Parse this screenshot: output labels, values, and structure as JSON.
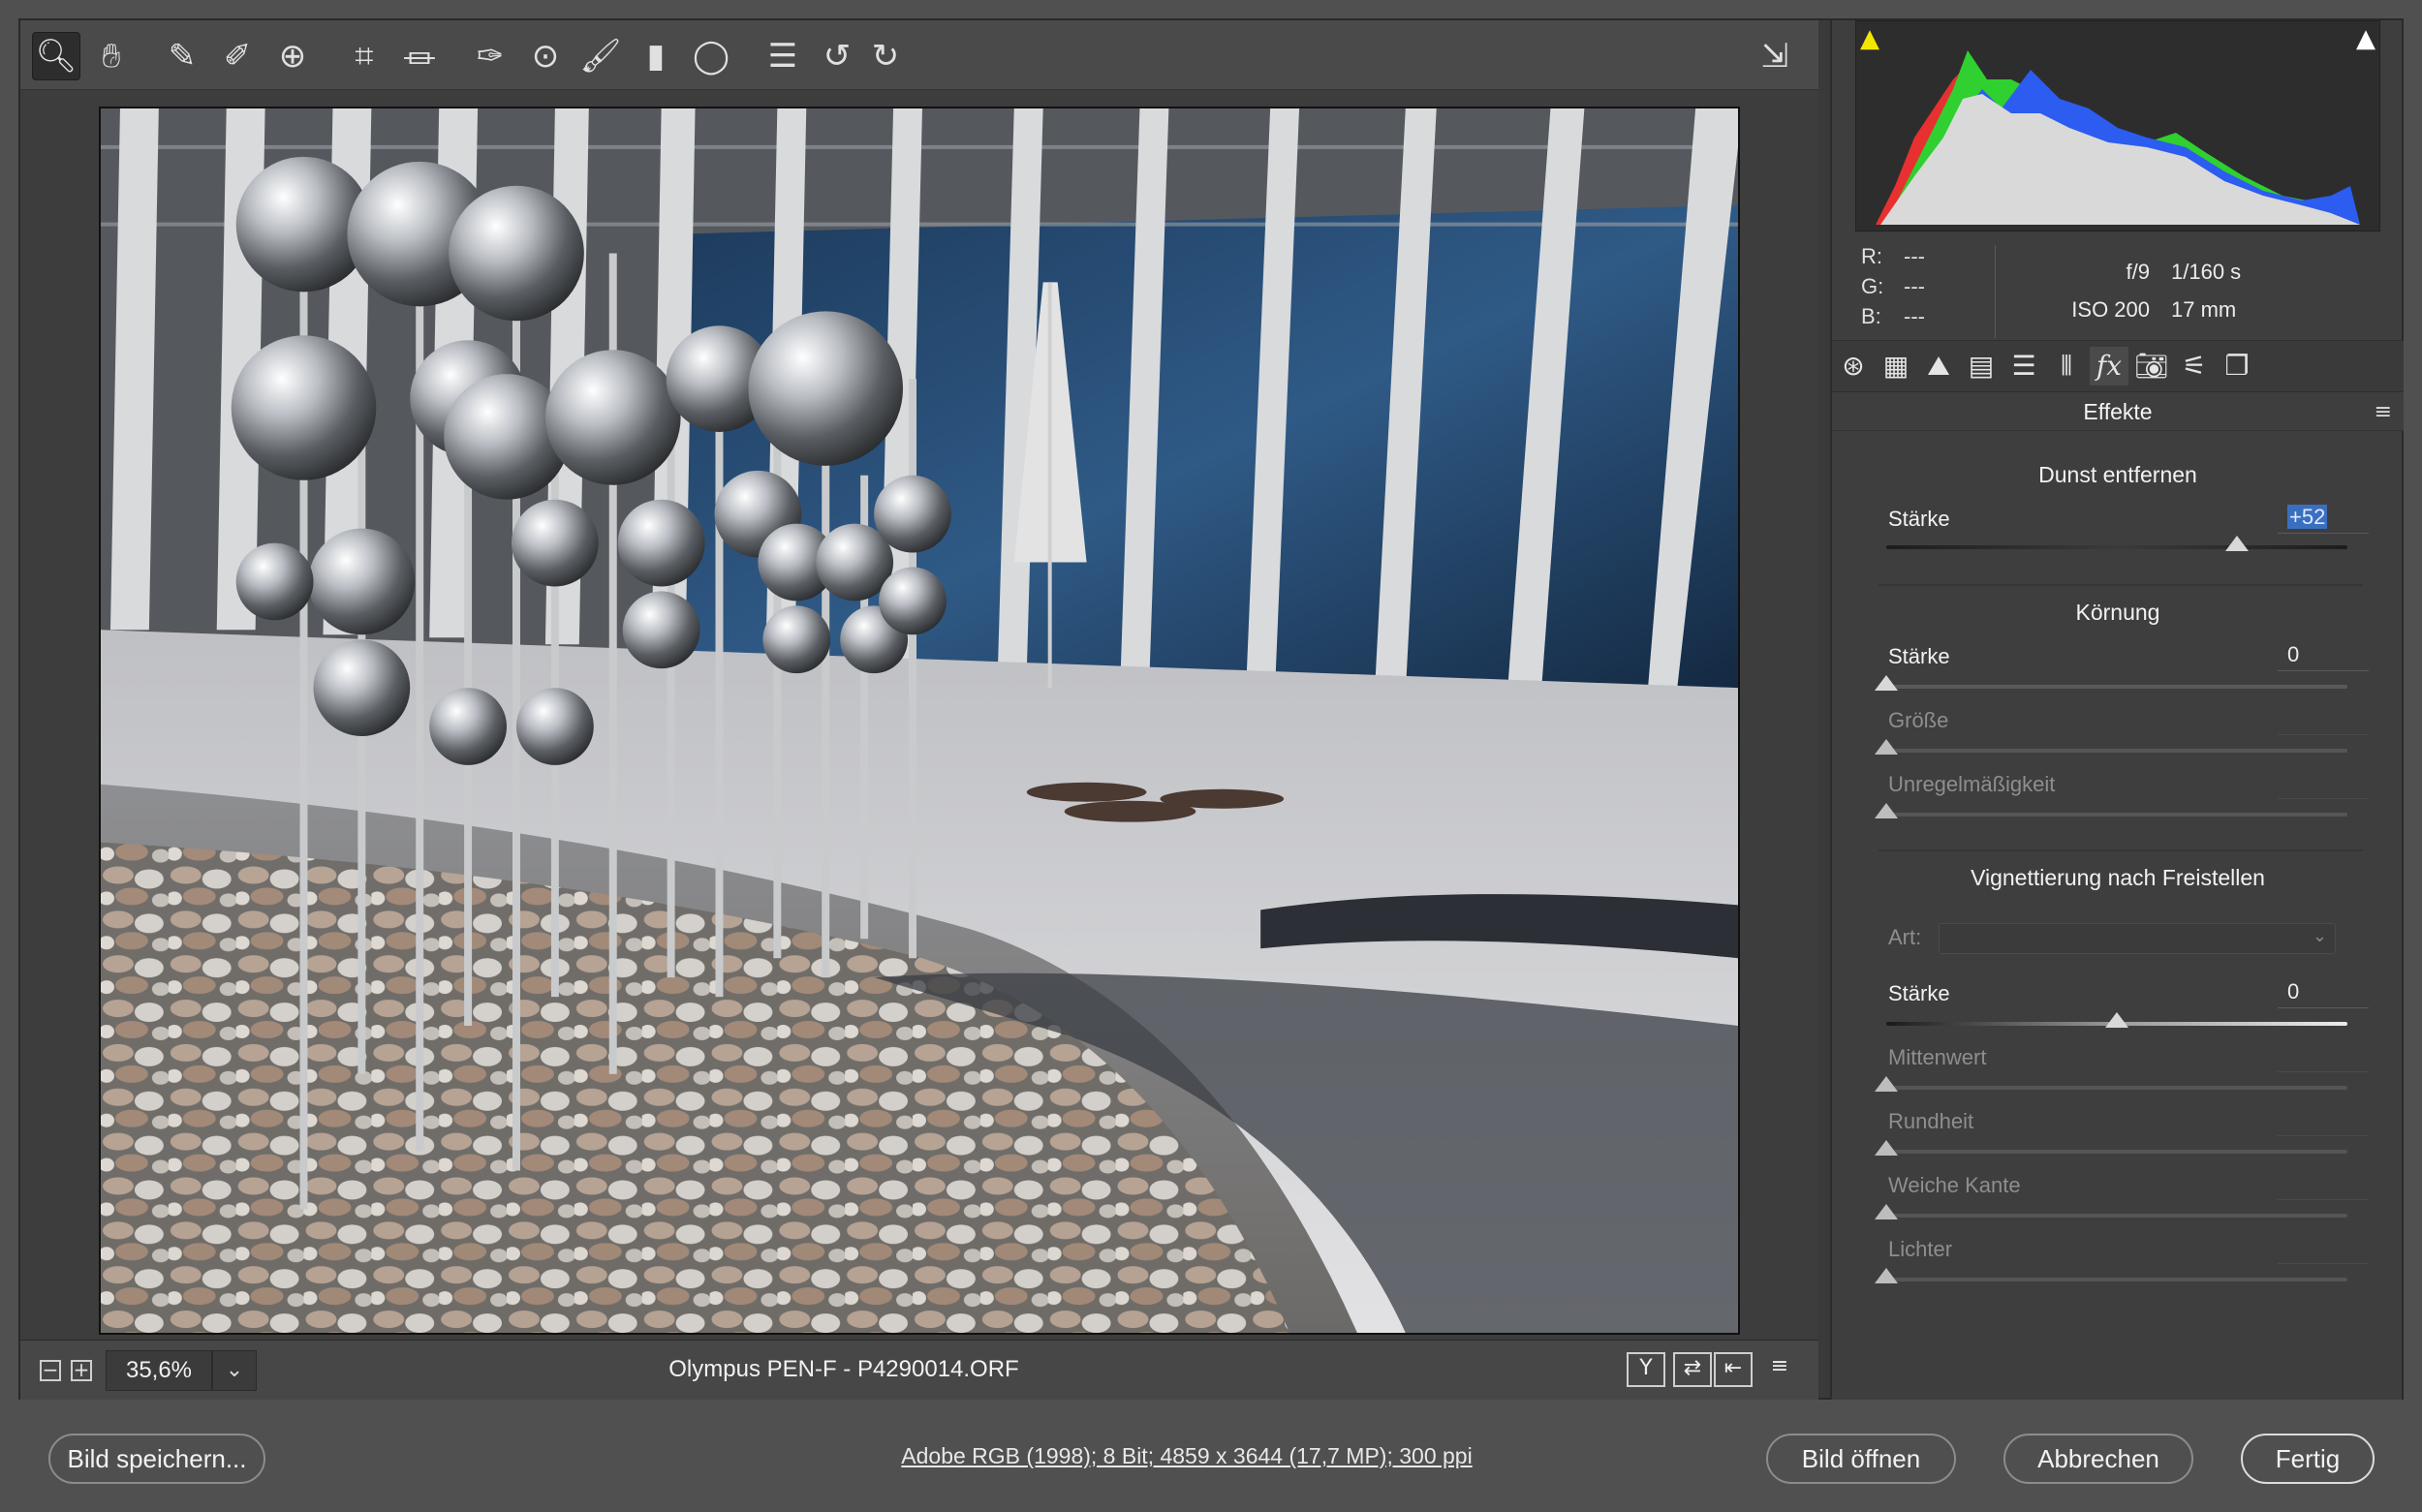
{
  "toolbar": {
    "tools": [
      {
        "name": "zoom-tool",
        "icon": "magnifier-icon",
        "glyph": "🔍︎"
      },
      {
        "name": "hand-tool",
        "icon": "hand-icon",
        "glyph": "✋︎"
      },
      {
        "name": "white-balance-tool",
        "icon": "eyedropper-icon",
        "glyph": "✎"
      },
      {
        "name": "color-sampler-tool",
        "icon": "eyedropper-plus-icon",
        "glyph": "✐"
      },
      {
        "name": "targeted-adjustment-tool",
        "icon": "target-icon",
        "glyph": "⊕"
      },
      {
        "name": "crop-tool",
        "icon": "crop-icon",
        "glyph": "⌗"
      },
      {
        "name": "straighten-tool",
        "icon": "level-icon",
        "glyph": "⏛"
      },
      {
        "name": "spot-removal-tool",
        "icon": "brush-spot-icon",
        "glyph": "✑"
      },
      {
        "name": "red-eye-tool",
        "icon": "eye-plus-icon",
        "glyph": "⊙"
      },
      {
        "name": "adjustment-brush-tool",
        "icon": "brush-icon",
        "glyph": "🖌︎"
      },
      {
        "name": "graduated-filter-tool",
        "icon": "gradient-icon",
        "glyph": "▮"
      },
      {
        "name": "radial-filter-tool",
        "icon": "ellipse-icon",
        "glyph": "◯"
      },
      {
        "name": "preferences-tool",
        "icon": "list-icon",
        "glyph": "☰"
      },
      {
        "name": "rotate-left-tool",
        "icon": "rotate-ccw-icon",
        "glyph": "↺"
      },
      {
        "name": "rotate-right-tool",
        "icon": "rotate-cw-icon",
        "glyph": "↻"
      }
    ],
    "fullscreen_icon": "fullscreen-icon"
  },
  "status": {
    "zoom_out": "−",
    "zoom_in": "+",
    "zoom_value": "35,6%",
    "filename": "Olympus PEN-F - P4290014.ORF",
    "view_buttons": [
      "Y",
      "⇄",
      "⇤",
      "≡"
    ]
  },
  "histogram": {
    "shadow_clip_color": "#f2e600",
    "highlight_clip_color": "#ffffff"
  },
  "rgb_readout": {
    "r_label": "R:",
    "r_value": "---",
    "g_label": "G:",
    "g_value": "---",
    "b_label": "B:",
    "b_value": "---"
  },
  "exif": {
    "aperture": "f/9",
    "shutter": "1/160 s",
    "iso": "ISO 200",
    "focal_length": "17 mm"
  },
  "panel_tabs": [
    "aperture-icon",
    "grid-icon",
    "mountain-icon",
    "hsl-icon",
    "split-toning-icon",
    "lens-icon",
    "fx-icon",
    "camera-icon",
    "presets-icon",
    "snapshots-icon"
  ],
  "panel": {
    "title": "Effekte",
    "dehaze": {
      "title": "Dunst entfernen",
      "amount_label": "Stärke",
      "amount_value": "+52",
      "amount_level": 0.76
    },
    "grain": {
      "title": "Körnung",
      "amount_label": "Stärke",
      "amount_value": "0",
      "size_label": "Größe",
      "roughness_label": "Unregelmäßigkeit"
    },
    "vignette": {
      "title": "Vignettierung nach Freistellen",
      "style_label": "Art:",
      "amount_label": "Stärke",
      "amount_value": "0",
      "amount_level": 0.5,
      "midpoint_label": "Mittenwert",
      "roundness_label": "Rundheit",
      "feather_label": "Weiche Kante",
      "highlights_label": "Lichter"
    }
  },
  "footer": {
    "save_label": "Bild speichern...",
    "workflow_options": "Adobe RGB (1998); 8 Bit; 4859 x 3644 (17,7 MP); 300 ppi",
    "open_label": "Bild öffnen",
    "cancel_label": "Abbrechen",
    "done_label": "Fertig"
  }
}
